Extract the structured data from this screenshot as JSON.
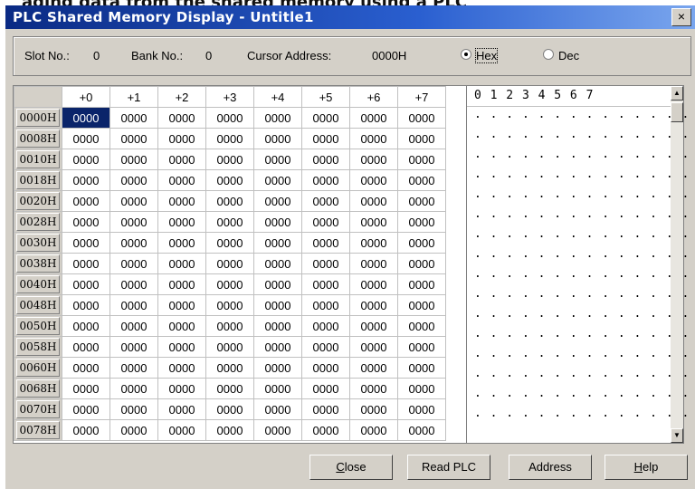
{
  "clipped_caption": "ading data from the shared memory using a PLC",
  "window": {
    "title": "PLC Shared Memory Display - Untitle1",
    "close_glyph": "×"
  },
  "info": {
    "slot_label": "Slot No.:",
    "slot_value": "0",
    "bank_label": "Bank No.:",
    "bank_value": "0",
    "cursor_label": "Cursor Address:",
    "cursor_value": "0000H",
    "hex_label": "Hex",
    "dec_label": "Dec",
    "selected_radix": "Hex"
  },
  "grid": {
    "column_headers": [
      "+0",
      "+1",
      "+2",
      "+3",
      "+4",
      "+5",
      "+6",
      "+7"
    ],
    "rows": [
      {
        "addr": "0000H",
        "values": [
          "0000",
          "0000",
          "0000",
          "0000",
          "0000",
          "0000",
          "0000",
          "0000"
        ],
        "ascii": ". . . . . . . . . . . . . . ."
      },
      {
        "addr": "0008H",
        "values": [
          "0000",
          "0000",
          "0000",
          "0000",
          "0000",
          "0000",
          "0000",
          "0000"
        ],
        "ascii": ". . . . . . . . . . . . . . ."
      },
      {
        "addr": "0010H",
        "values": [
          "0000",
          "0000",
          "0000",
          "0000",
          "0000",
          "0000",
          "0000",
          "0000"
        ],
        "ascii": ". . . . . . . . . . . . . . ."
      },
      {
        "addr": "0018H",
        "values": [
          "0000",
          "0000",
          "0000",
          "0000",
          "0000",
          "0000",
          "0000",
          "0000"
        ],
        "ascii": ". . . . . . . . . . . . . . ."
      },
      {
        "addr": "0020H",
        "values": [
          "0000",
          "0000",
          "0000",
          "0000",
          "0000",
          "0000",
          "0000",
          "0000"
        ],
        "ascii": ". . . . . . . . . . . . . . ."
      },
      {
        "addr": "0028H",
        "values": [
          "0000",
          "0000",
          "0000",
          "0000",
          "0000",
          "0000",
          "0000",
          "0000"
        ],
        "ascii": ". . . . . . . . . . . . . . ."
      },
      {
        "addr": "0030H",
        "values": [
          "0000",
          "0000",
          "0000",
          "0000",
          "0000",
          "0000",
          "0000",
          "0000"
        ],
        "ascii": ". . . . . . . . . . . . . . ."
      },
      {
        "addr": "0038H",
        "values": [
          "0000",
          "0000",
          "0000",
          "0000",
          "0000",
          "0000",
          "0000",
          "0000"
        ],
        "ascii": ". . . . . . . . . . . . . . ."
      },
      {
        "addr": "0040H",
        "values": [
          "0000",
          "0000",
          "0000",
          "0000",
          "0000",
          "0000",
          "0000",
          "0000"
        ],
        "ascii": ". . . . . . . . . . . . . . ."
      },
      {
        "addr": "0048H",
        "values": [
          "0000",
          "0000",
          "0000",
          "0000",
          "0000",
          "0000",
          "0000",
          "0000"
        ],
        "ascii": ". . . . . . . . . . . . . . ."
      },
      {
        "addr": "0050H",
        "values": [
          "0000",
          "0000",
          "0000",
          "0000",
          "0000",
          "0000",
          "0000",
          "0000"
        ],
        "ascii": ". . . . . . . . . . . . . . ."
      },
      {
        "addr": "0058H",
        "values": [
          "0000",
          "0000",
          "0000",
          "0000",
          "0000",
          "0000",
          "0000",
          "0000"
        ],
        "ascii": ". . . . . . . . . . . . . . ."
      },
      {
        "addr": "0060H",
        "values": [
          "0000",
          "0000",
          "0000",
          "0000",
          "0000",
          "0000",
          "0000",
          "0000"
        ],
        "ascii": ". . . . . . . . . . . . . . ."
      },
      {
        "addr": "0068H",
        "values": [
          "0000",
          "0000",
          "0000",
          "0000",
          "0000",
          "0000",
          "0000",
          "0000"
        ],
        "ascii": ". . . . . . . . . . . . . . ."
      },
      {
        "addr": "0070H",
        "values": [
          "0000",
          "0000",
          "0000",
          "0000",
          "0000",
          "0000",
          "0000",
          "0000"
        ],
        "ascii": ". . . . . . . . . . . . . . ."
      },
      {
        "addr": "0078H",
        "values": [
          "0000",
          "0000",
          "0000",
          "0000",
          "0000",
          "0000",
          "0000",
          "0000"
        ],
        "ascii": ". . . . . . . . . . . . . . ."
      }
    ],
    "ascii_header": "0 1 2 3 4 5 6 7",
    "selected_cell": {
      "row": 0,
      "col": 0
    }
  },
  "buttons": {
    "close": {
      "accel": "C",
      "rest": "lose"
    },
    "read_plc": "Read PLC",
    "address": "Address",
    "help": {
      "accel": "H",
      "rest": "elp"
    }
  },
  "colors": {
    "title_gradient_start": "#0a2a84",
    "face": "#d4d0c8",
    "selection": "#0a246a"
  },
  "icons": {
    "scroll_up": "scroll-up-arrow-icon",
    "scroll_down": "scroll-down-arrow-icon"
  }
}
